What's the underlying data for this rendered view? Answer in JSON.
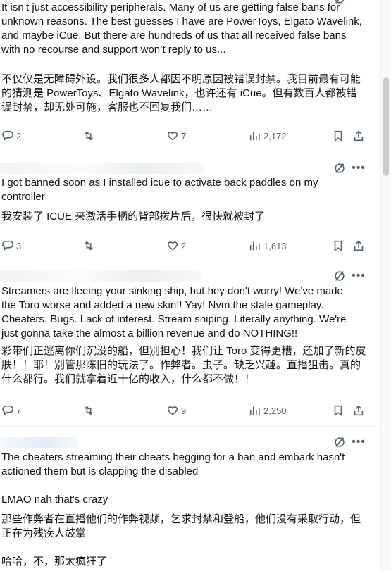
{
  "posts": [
    {
      "text_en": [
        "It isn’t just accessibility peripherals. Many of us are getting false bans for",
        "unknown reasons. The best guesses I have are PowerToys, Elgato Wavelink,",
        "and maybe iCue. But there are hundreds of us that all received false bans",
        "with no recourse and support won’t reply to us..."
      ],
      "text_zh": [
        "不仅仅是无障碍外设。我们很多人都因不明原因被错误封禁。我目前最有可能",
        "的猜测是 PowerToys、Elgato Wavelink，也许还有 iCue。但有数百人都被错",
        "误封禁，却无处可施，客服也不回复我们……"
      ],
      "replies": "2",
      "reposts": "",
      "likes": "7",
      "views": "2,172"
    },
    {
      "text_en": [
        "I got banned soon as I installed icue to activate back paddles on my",
        "controller"
      ],
      "text_zh": [
        "我安装了 ICUE 来激活手柄的背部拨片后，很快就被封了"
      ],
      "replies": "3",
      "reposts": "",
      "likes": "2",
      "views": "1,613"
    },
    {
      "text_en": [
        "Streamers are fleeing your sinking ship, but hey don't worry! We've made",
        "the Toro worse and added a new skin!! Yay! Nvm the stale gameplay.",
        "Cheaters. Bugs. Lack of interest. Stream sniping. Literally anything. We're",
        "just gonna take the almost a billion revenue and do NOTHING!!"
      ],
      "text_zh": [
        "彩带们正逃离你们沉没的船，但别担心！我们让 Toro 变得更糟，还加了新的皮",
        "肤！！耶！别管那陈旧的玩法了。作弊者。虫子。缺乏兴趣。直播狙击。真的",
        "什么都行。我们就拿着近十亿的收入，什么都不做！！"
      ],
      "replies": "7",
      "reposts": "",
      "likes": "9",
      "views": "2,250"
    },
    {
      "text_en": [
        "The cheaters streaming their cheats begging for a ban and embark hasn't",
        "actioned them but is clapping the disabled",
        "",
        "LMAO nah that's crazy"
      ],
      "text_zh": [
        "那些作弊者在直播他们的作弊视频，乞求封禁和登船，他们没有采取行动，但",
        "正在为残疾人鼓掌",
        "",
        "哈哈，不，那太疯狂了"
      ]
    }
  ],
  "icons": {
    "reply": "reply-icon",
    "repost": "repost-icon",
    "like": "heart-icon",
    "views": "views-icon",
    "bookmark": "bookmark-icon",
    "share": "share-icon",
    "grok": "grok-icon",
    "more": "more-icon"
  },
  "more_label": "•••",
  "colors": {
    "text": "#0f1419",
    "muted": "#536471",
    "divider": "#eff3f4"
  }
}
